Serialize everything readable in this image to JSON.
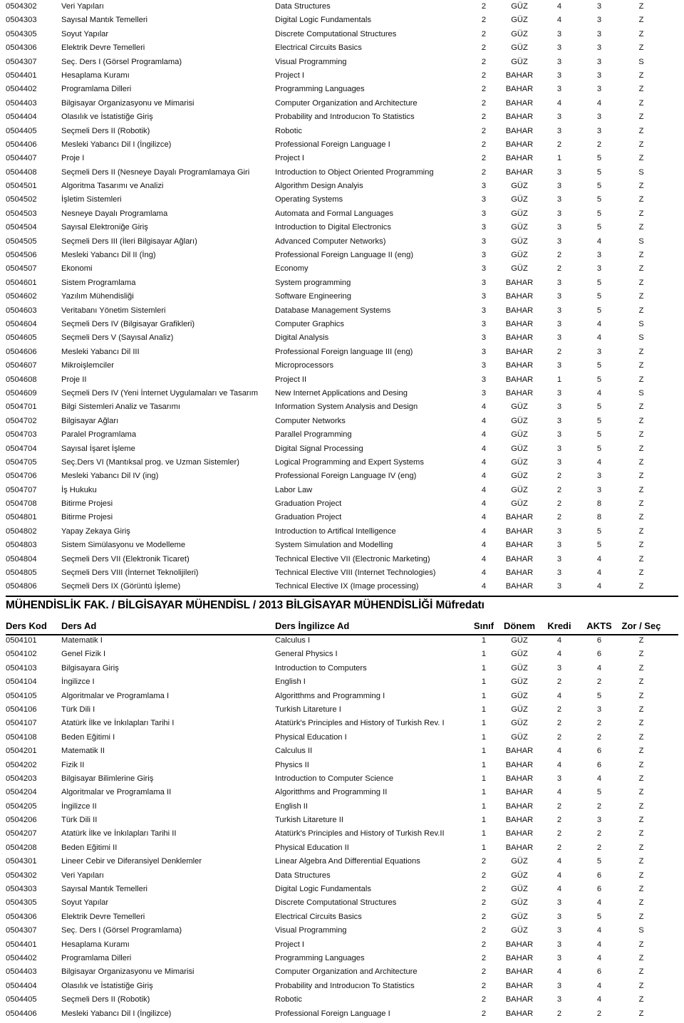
{
  "columns": {
    "code": "Ders Kod",
    "name_tr": "Ders Ad",
    "name_en": "Ders İngilizce Ad",
    "year": "Sınıf",
    "term": "Dönem",
    "credit": "Kredi",
    "ects": "AKTS",
    "type": "Zor / Seç"
  },
  "section": {
    "title": "MÜHENDİSLİK FAK. / BİLGİSAYAR MÜHENDİSL / 2013 BİLGİSAYAR MÜHENDİSLİĞİ Müfredatı"
  },
  "top_rows": [
    {
      "code": "0504302",
      "name_tr": "Veri Yapıları",
      "name_en": "Data Structures",
      "year": "2",
      "term": "GÜZ",
      "credit": "4",
      "ects": "3",
      "type": "Z"
    },
    {
      "code": "0504303",
      "name_tr": "Sayısal Mantık Temelleri",
      "name_en": "Digital Logic Fundamentals",
      "year": "2",
      "term": "GÜZ",
      "credit": "4",
      "ects": "3",
      "type": "Z"
    },
    {
      "code": "0504305",
      "name_tr": "Soyut Yapılar",
      "name_en": "Discrete Computational Structures",
      "year": "2",
      "term": "GÜZ",
      "credit": "3",
      "ects": "3",
      "type": "Z"
    },
    {
      "code": "0504306",
      "name_tr": "Elektrik Devre Temelleri",
      "name_en": "Electrical Circuits Basics",
      "year": "2",
      "term": "GÜZ",
      "credit": "3",
      "ects": "3",
      "type": "Z"
    },
    {
      "code": "0504307",
      "name_tr": "Seç. Ders I (Görsel Programlama)",
      "name_en": "Visual Programming",
      "year": "2",
      "term": "GÜZ",
      "credit": "3",
      "ects": "3",
      "type": "S"
    },
    {
      "code": "0504401",
      "name_tr": "Hesaplama Kuramı",
      "name_en": "Project I",
      "year": "2",
      "term": "BAHAR",
      "credit": "3",
      "ects": "3",
      "type": "Z"
    },
    {
      "code": "0504402",
      "name_tr": "Programlama Dilleri",
      "name_en": "Programming Languages",
      "year": "2",
      "term": "BAHAR",
      "credit": "3",
      "ects": "3",
      "type": "Z"
    },
    {
      "code": "0504403",
      "name_tr": "Bilgisayar Organizasyonu ve Mimarisi",
      "name_en": "Computer Organization and Architecture",
      "year": "2",
      "term": "BAHAR",
      "credit": "4",
      "ects": "4",
      "type": "Z"
    },
    {
      "code": "0504404",
      "name_tr": "Olasılık ve İstatistiğe Giriş",
      "name_en": "Probability and Introducıon To Statistics",
      "year": "2",
      "term": "BAHAR",
      "credit": "3",
      "ects": "3",
      "type": "Z"
    },
    {
      "code": "0504405",
      "name_tr": "Seçmeli Ders II (Robotik)",
      "name_en": "Robotic",
      "year": "2",
      "term": "BAHAR",
      "credit": "3",
      "ects": "3",
      "type": "Z"
    },
    {
      "code": "0504406",
      "name_tr": "Mesleki Yabancı Dil I (İngilizce)",
      "name_en": "Professional Foreign Language I",
      "year": "2",
      "term": "BAHAR",
      "credit": "2",
      "ects": "2",
      "type": "Z"
    },
    {
      "code": "0504407",
      "name_tr": "Proje I",
      "name_en": "Project I",
      "year": "2",
      "term": "BAHAR",
      "credit": "1",
      "ects": "5",
      "type": "Z"
    },
    {
      "code": "0504408",
      "name_tr": "Seçmeli Ders II (Nesneye Dayalı Programlamaya Giri",
      "name_en": "Introduction to Object Oriented Programming",
      "year": "2",
      "term": "BAHAR",
      "credit": "3",
      "ects": "5",
      "type": "S"
    },
    {
      "code": "0504501",
      "name_tr": "Algoritma Tasarımı ve Analizi",
      "name_en": "Algorithm Design Analyis",
      "year": "3",
      "term": "GÜZ",
      "credit": "3",
      "ects": "5",
      "type": "Z"
    },
    {
      "code": "0504502",
      "name_tr": "İşletim Sistemleri",
      "name_en": "Operating Systems",
      "year": "3",
      "term": "GÜZ",
      "credit": "3",
      "ects": "5",
      "type": "Z"
    },
    {
      "code": "0504503",
      "name_tr": "Nesneye Dayalı Programlama",
      "name_en": "Automata and Formal Languages",
      "year": "3",
      "term": "GÜZ",
      "credit": "3",
      "ects": "5",
      "type": "Z"
    },
    {
      "code": "0504504",
      "name_tr": "Sayısal Elektroniğe Giriş",
      "name_en": "Introduction to Digital Electronics",
      "year": "3",
      "term": "GÜZ",
      "credit": "3",
      "ects": "5",
      "type": "Z"
    },
    {
      "code": "0504505",
      "name_tr": "Seçmeli Ders III (İleri Bilgisayar Ağları)",
      "name_en": "Advanced Computer Networks)",
      "year": "3",
      "term": "GÜZ",
      "credit": "3",
      "ects": "4",
      "type": "S"
    },
    {
      "code": "0504506",
      "name_tr": "Mesleki Yabancı Dil II (İng)",
      "name_en": "Professional Foreign Language II (eng)",
      "year": "3",
      "term": "GÜZ",
      "credit": "2",
      "ects": "3",
      "type": "Z"
    },
    {
      "code": "0504507",
      "name_tr": "Ekonomi",
      "name_en": "Economy",
      "year": "3",
      "term": "GÜZ",
      "credit": "2",
      "ects": "3",
      "type": "Z"
    },
    {
      "code": "0504601",
      "name_tr": "Sistem Programlama",
      "name_en": "System programming",
      "year": "3",
      "term": "BAHAR",
      "credit": "3",
      "ects": "5",
      "type": "Z"
    },
    {
      "code": "0504602",
      "name_tr": "Yazılım Mühendisliği",
      "name_en": "Software Engineering",
      "year": "3",
      "term": "BAHAR",
      "credit": "3",
      "ects": "5",
      "type": "Z"
    },
    {
      "code": "0504603",
      "name_tr": "Veritabanı Yönetim Sistemleri",
      "name_en": "Database Management Systems",
      "year": "3",
      "term": "BAHAR",
      "credit": "3",
      "ects": "5",
      "type": "Z"
    },
    {
      "code": "0504604",
      "name_tr": "Seçmeli Ders IV (Bilgisayar Grafikleri)",
      "name_en": "Computer Graphics",
      "year": "3",
      "term": "BAHAR",
      "credit": "3",
      "ects": "4",
      "type": "S"
    },
    {
      "code": "0504605",
      "name_tr": "Seçmeli Ders V (Sayısal Analiz)",
      "name_en": "Digital Analysis",
      "year": "3",
      "term": "BAHAR",
      "credit": "3",
      "ects": "4",
      "type": "S"
    },
    {
      "code": "0504606",
      "name_tr": "Mesleki Yabancı Dil III",
      "name_en": "Professional Foreign language III (eng)",
      "year": "3",
      "term": "BAHAR",
      "credit": "2",
      "ects": "3",
      "type": "Z"
    },
    {
      "code": "0504607",
      "name_tr": "Mikroişlemciler",
      "name_en": "Microprocessors",
      "year": "3",
      "term": "BAHAR",
      "credit": "3",
      "ects": "5",
      "type": "Z"
    },
    {
      "code": "0504608",
      "name_tr": "Proje II",
      "name_en": "Project II",
      "year": "3",
      "term": "BAHAR",
      "credit": "1",
      "ects": "5",
      "type": "Z"
    },
    {
      "code": "0504609",
      "name_tr": "Seçmeli Ders IV (Yeni İnternet Uygulamaları ve Tasarım",
      "name_en": "New Internet Applications and Desing",
      "year": "3",
      "term": "BAHAR",
      "credit": "3",
      "ects": "4",
      "type": "S"
    },
    {
      "code": "0504701",
      "name_tr": "Bilgi Sistemleri Analiz ve Tasarımı",
      "name_en": "Information System Analysis and Design",
      "year": "4",
      "term": "GÜZ",
      "credit": "3",
      "ects": "5",
      "type": "Z"
    },
    {
      "code": "0504702",
      "name_tr": "Bilgisayar Ağları",
      "name_en": "Computer Networks",
      "year": "4",
      "term": "GÜZ",
      "credit": "3",
      "ects": "5",
      "type": "Z"
    },
    {
      "code": "0504703",
      "name_tr": "Paralel Programlama",
      "name_en": "Parallel Programming",
      "year": "4",
      "term": "GÜZ",
      "credit": "3",
      "ects": "5",
      "type": "Z"
    },
    {
      "code": "0504704",
      "name_tr": "Sayısal İşaret İşleme",
      "name_en": "Digital Signal Processing",
      "year": "4",
      "term": "GÜZ",
      "credit": "3",
      "ects": "5",
      "type": "Z"
    },
    {
      "code": "0504705",
      "name_tr": "Seç.Ders VI (Mantıksal prog. ve Uzman Sistemler)",
      "name_en": "Logical Programming and Expert Systems",
      "year": "4",
      "term": "GÜZ",
      "credit": "3",
      "ects": "4",
      "type": "Z"
    },
    {
      "code": "0504706",
      "name_tr": "Mesleki Yabancı Dil IV (ing)",
      "name_en": "Professional Foreign Language IV (eng)",
      "year": "4",
      "term": "GÜZ",
      "credit": "2",
      "ects": "3",
      "type": "Z"
    },
    {
      "code": "0504707",
      "name_tr": "İş Hukuku",
      "name_en": "Labor Law",
      "year": "4",
      "term": "GÜZ",
      "credit": "2",
      "ects": "3",
      "type": "Z"
    },
    {
      "code": "0504708",
      "name_tr": "Bitirme Projesi",
      "name_en": "Graduation Project",
      "year": "4",
      "term": "GÜZ",
      "credit": "2",
      "ects": "8",
      "type": "Z"
    },
    {
      "code": "0504801",
      "name_tr": "Bitirme Projesi",
      "name_en": "Graduation Project",
      "year": "4",
      "term": "BAHAR",
      "credit": "2",
      "ects": "8",
      "type": "Z"
    },
    {
      "code": "0504802",
      "name_tr": "Yapay Zekaya Giriş",
      "name_en": "Introduction to Artifical Intelligence",
      "year": "4",
      "term": "BAHAR",
      "credit": "3",
      "ects": "5",
      "type": "Z"
    },
    {
      "code": "0504803",
      "name_tr": "Sistem Simülasyonu ve Modelleme",
      "name_en": "System Simulation and Modelling",
      "year": "4",
      "term": "BAHAR",
      "credit": "3",
      "ects": "5",
      "type": "Z"
    },
    {
      "code": "0504804",
      "name_tr": "Seçmeli Ders VII (Elektronik Ticaret)",
      "name_en": "Technical Elective VII (Electronic Marketing)",
      "year": "4",
      "term": "BAHAR",
      "credit": "3",
      "ects": "4",
      "type": "Z"
    },
    {
      "code": "0504805",
      "name_tr": "Seçmeli Ders VIII (İnternet Teknolijileri)",
      "name_en": "Technical Elective VIII (Internet Technologies)",
      "year": "4",
      "term": "BAHAR",
      "credit": "3",
      "ects": "4",
      "type": "Z"
    },
    {
      "code": "0504806",
      "name_tr": "Seçmeli Ders IX (Görüntü İşleme)",
      "name_en": "Technical Elective IX (Image processing)",
      "year": "4",
      "term": "BAHAR",
      "credit": "3",
      "ects": "4",
      "type": "Z"
    }
  ],
  "bottom_rows": [
    {
      "code": "0504101",
      "name_tr": "Matematik I",
      "name_en": "Calculus I",
      "year": "1",
      "term": "GÜZ",
      "credit": "4",
      "ects": "6",
      "type": "Z"
    },
    {
      "code": "0504102",
      "name_tr": "Genel Fizik I",
      "name_en": "General Physics I",
      "year": "1",
      "term": "GÜZ",
      "credit": "4",
      "ects": "6",
      "type": "Z"
    },
    {
      "code": "0504103",
      "name_tr": "Bilgisayara Giriş",
      "name_en": "Introduction to Computers",
      "year": "1",
      "term": "GÜZ",
      "credit": "3",
      "ects": "4",
      "type": "Z"
    },
    {
      "code": "0504104",
      "name_tr": "İngilizce I",
      "name_en": "English I",
      "year": "1",
      "term": "GÜZ",
      "credit": "2",
      "ects": "2",
      "type": "Z"
    },
    {
      "code": "0504105",
      "name_tr": "Algoritmalar ve Programlama I",
      "name_en": "Algoritthms and Programming I",
      "year": "1",
      "term": "GÜZ",
      "credit": "4",
      "ects": "5",
      "type": "Z"
    },
    {
      "code": "0504106",
      "name_tr": "Türk Dili I",
      "name_en": "Turkish Litareture I",
      "year": "1",
      "term": "GÜZ",
      "credit": "2",
      "ects": "3",
      "type": "Z"
    },
    {
      "code": "0504107",
      "name_tr": "Atatürk İlke ve İnkılapları Tarihi I",
      "name_en": "Atatürk's Principles and History of Turkish Rev. I",
      "year": "1",
      "term": "GÜZ",
      "credit": "2",
      "ects": "2",
      "type": "Z"
    },
    {
      "code": "0504108",
      "name_tr": "Beden Eğitimi I",
      "name_en": "Physical Education I",
      "year": "1",
      "term": "GÜZ",
      "credit": "2",
      "ects": "2",
      "type": "Z"
    },
    {
      "code": "0504201",
      "name_tr": "Matematik II",
      "name_en": "Calculus II",
      "year": "1",
      "term": "BAHAR",
      "credit": "4",
      "ects": "6",
      "type": "Z"
    },
    {
      "code": "0504202",
      "name_tr": "Fizik II",
      "name_en": "Physics II",
      "year": "1",
      "term": "BAHAR",
      "credit": "4",
      "ects": "6",
      "type": "Z"
    },
    {
      "code": "0504203",
      "name_tr": "Bilgisayar Bilimlerine Giriş",
      "name_en": "Introduction to Computer Science",
      "year": "1",
      "term": "BAHAR",
      "credit": "3",
      "ects": "4",
      "type": "Z"
    },
    {
      "code": "0504204",
      "name_tr": "Algoritmalar ve Programlama II",
      "name_en": "Algoritthms and Programming II",
      "year": "1",
      "term": "BAHAR",
      "credit": "4",
      "ects": "5",
      "type": "Z"
    },
    {
      "code": "0504205",
      "name_tr": "İngilizce II",
      "name_en": "English II",
      "year": "1",
      "term": "BAHAR",
      "credit": "2",
      "ects": "2",
      "type": "Z"
    },
    {
      "code": "0504206",
      "name_tr": "Türk Dili II",
      "name_en": "Turkish Litareture II",
      "year": "1",
      "term": "BAHAR",
      "credit": "2",
      "ects": "3",
      "type": "Z"
    },
    {
      "code": "0504207",
      "name_tr": "Atatürk İlke ve İnkılapları Tarihi II",
      "name_en": "Atatürk's Principles and History of Turkish Rev.II",
      "year": "1",
      "term": "BAHAR",
      "credit": "2",
      "ects": "2",
      "type": "Z"
    },
    {
      "code": "0504208",
      "name_tr": "Beden Eğitimi II",
      "name_en": "Physical Education II",
      "year": "1",
      "term": "BAHAR",
      "credit": "2",
      "ects": "2",
      "type": "Z"
    },
    {
      "code": "0504301",
      "name_tr": "Lineer Cebir ve Diferansiyel Denklemler",
      "name_en": "Linear Algebra And Differential Equations",
      "year": "2",
      "term": "GÜZ",
      "credit": "4",
      "ects": "5",
      "type": "Z"
    },
    {
      "code": "0504302",
      "name_tr": "Veri Yapıları",
      "name_en": "Data Structures",
      "year": "2",
      "term": "GÜZ",
      "credit": "4",
      "ects": "6",
      "type": "Z"
    },
    {
      "code": "0504303",
      "name_tr": "Sayısal Mantık Temelleri",
      "name_en": "Digital Logic Fundamentals",
      "year": "2",
      "term": "GÜZ",
      "credit": "4",
      "ects": "6",
      "type": "Z"
    },
    {
      "code": "0504305",
      "name_tr": "Soyut Yapılar",
      "name_en": "Discrete Computational Structures",
      "year": "2",
      "term": "GÜZ",
      "credit": "3",
      "ects": "4",
      "type": "Z"
    },
    {
      "code": "0504306",
      "name_tr": "Elektrik Devre Temelleri",
      "name_en": "Electrical Circuits Basics",
      "year": "2",
      "term": "GÜZ",
      "credit": "3",
      "ects": "5",
      "type": "Z"
    },
    {
      "code": "0504307",
      "name_tr": "Seç. Ders I (Görsel Programlama)",
      "name_en": "Visual Programming",
      "year": "2",
      "term": "GÜZ",
      "credit": "3",
      "ects": "4",
      "type": "S"
    },
    {
      "code": "0504401",
      "name_tr": "Hesaplama Kuramı",
      "name_en": "Project I",
      "year": "2",
      "term": "BAHAR",
      "credit": "3",
      "ects": "4",
      "type": "Z"
    },
    {
      "code": "0504402",
      "name_tr": "Programlama Dilleri",
      "name_en": "Programming Languages",
      "year": "2",
      "term": "BAHAR",
      "credit": "3",
      "ects": "4",
      "type": "Z"
    },
    {
      "code": "0504403",
      "name_tr": "Bilgisayar Organizasyonu ve Mimarisi",
      "name_en": "Computer Organization and Architecture",
      "year": "2",
      "term": "BAHAR",
      "credit": "4",
      "ects": "6",
      "type": "Z"
    },
    {
      "code": "0504404",
      "name_tr": "Olasılık ve İstatistiğe Giriş",
      "name_en": "Probability and Introducıon To Statistics",
      "year": "2",
      "term": "BAHAR",
      "credit": "3",
      "ects": "4",
      "type": "Z"
    },
    {
      "code": "0504405",
      "name_tr": "Seçmeli Ders II (Robotik)",
      "name_en": "Robotic",
      "year": "2",
      "term": "BAHAR",
      "credit": "3",
      "ects": "4",
      "type": "Z"
    },
    {
      "code": "0504406",
      "name_tr": "Mesleki Yabancı Dil I (İngilizce)",
      "name_en": "Professional Foreign Language I",
      "year": "2",
      "term": "BAHAR",
      "credit": "2",
      "ects": "2",
      "type": "Z"
    }
  ]
}
